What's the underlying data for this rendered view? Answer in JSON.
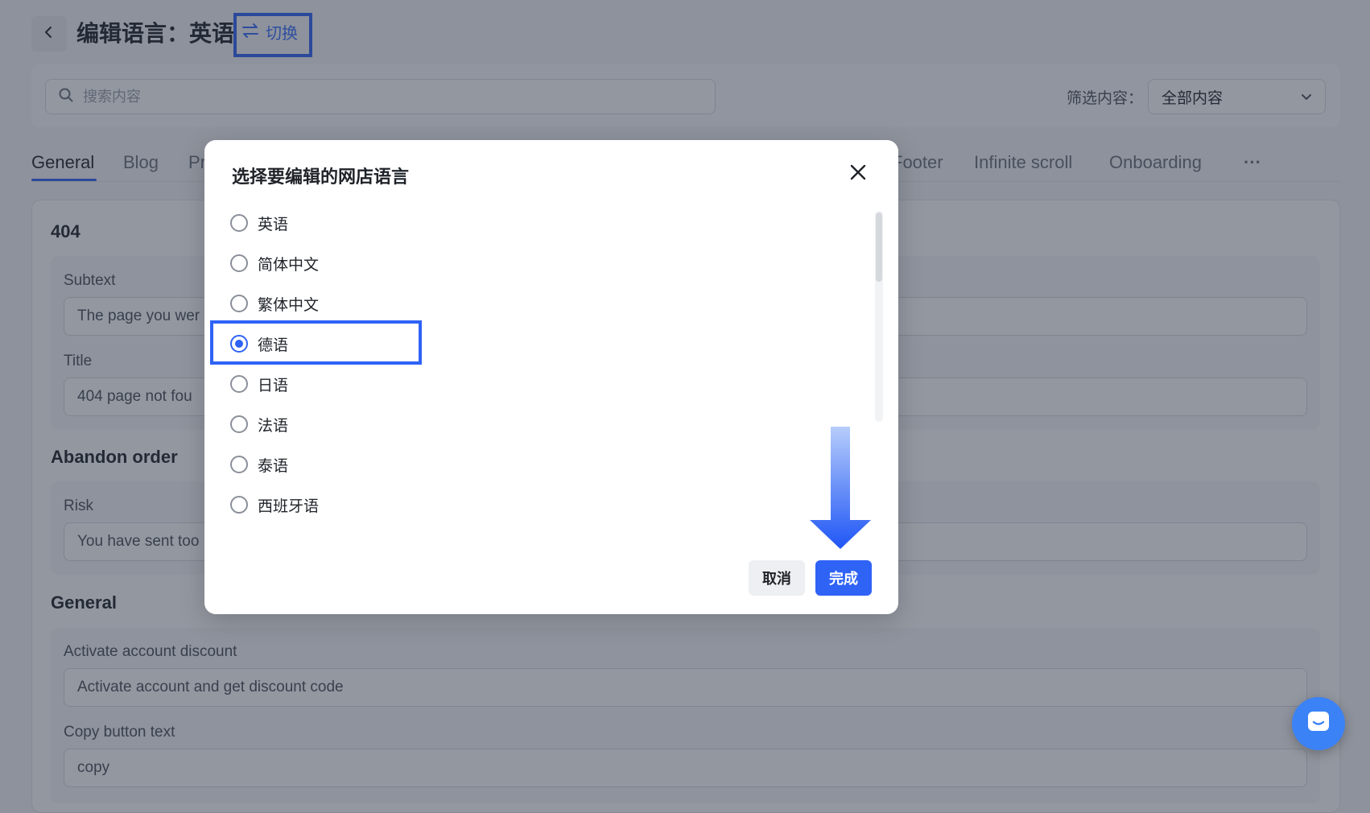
{
  "header": {
    "title": "编辑语言：英语",
    "switch_label": "切换"
  },
  "search": {
    "placeholder": "搜索内容",
    "filter_label": "筛选内容：",
    "filter_value": "全部内容"
  },
  "tabs": [
    {
      "label": "General",
      "active": true
    },
    {
      "label": "Blog",
      "active": false
    },
    {
      "label": "Pr",
      "active": false
    },
    {
      "label": "Footer",
      "active": false
    },
    {
      "label": "Infinite scroll",
      "active": false
    },
    {
      "label": "Onboarding",
      "active": false
    },
    {
      "label": "···",
      "active": false
    }
  ],
  "sections": [
    {
      "title": "404",
      "fields": [
        {
          "label": "Subtext",
          "value": "The page you wer"
        },
        {
          "label": "Title",
          "value": "404 page not fou"
        }
      ]
    },
    {
      "title": "Abandon order",
      "fields": [
        {
          "label": "Risk",
          "value": "You have sent too"
        }
      ]
    },
    {
      "title": "General",
      "fields": [
        {
          "label": "Activate account discount",
          "value": "Activate account and get discount code"
        },
        {
          "label": "Copy button text",
          "value": "copy"
        }
      ]
    }
  ],
  "dialog": {
    "title": "选择要编辑的网店语言",
    "options": [
      {
        "label": "英语",
        "checked": false
      },
      {
        "label": "简体中文",
        "checked": false
      },
      {
        "label": "繁体中文",
        "checked": false
      },
      {
        "label": "德语",
        "checked": true
      },
      {
        "label": "日语",
        "checked": false
      },
      {
        "label": "法语",
        "checked": false
      },
      {
        "label": "泰语",
        "checked": false
      },
      {
        "label": "西班牙语",
        "checked": false
      }
    ],
    "cancel_label": "取消",
    "done_label": "完成"
  },
  "colors": {
    "accent": "#2f63f5",
    "highlight_border": "#2f63f5",
    "overlay": "#282f42"
  }
}
